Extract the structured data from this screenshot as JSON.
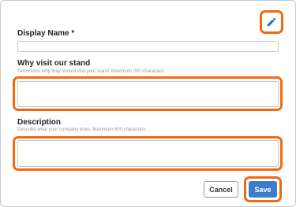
{
  "form": {
    "display_name": {
      "label": "Display Name *",
      "value": ""
    },
    "why_visit": {
      "label": "Why visit our stand",
      "hint": "Tell visitors why they should visit your stand. Maximum 200 characters",
      "value": ""
    },
    "description": {
      "label": "Description",
      "hint": "Describe what your company does. Maximum 600 characters",
      "value": ""
    }
  },
  "actions": {
    "cancel_label": "Cancel",
    "save_label": "Save"
  },
  "colors": {
    "highlight": "#f06a0f",
    "accent": "#3d7dca",
    "edit_icon": "#1f74c4"
  },
  "icons": {
    "edit": "pencil-icon"
  }
}
